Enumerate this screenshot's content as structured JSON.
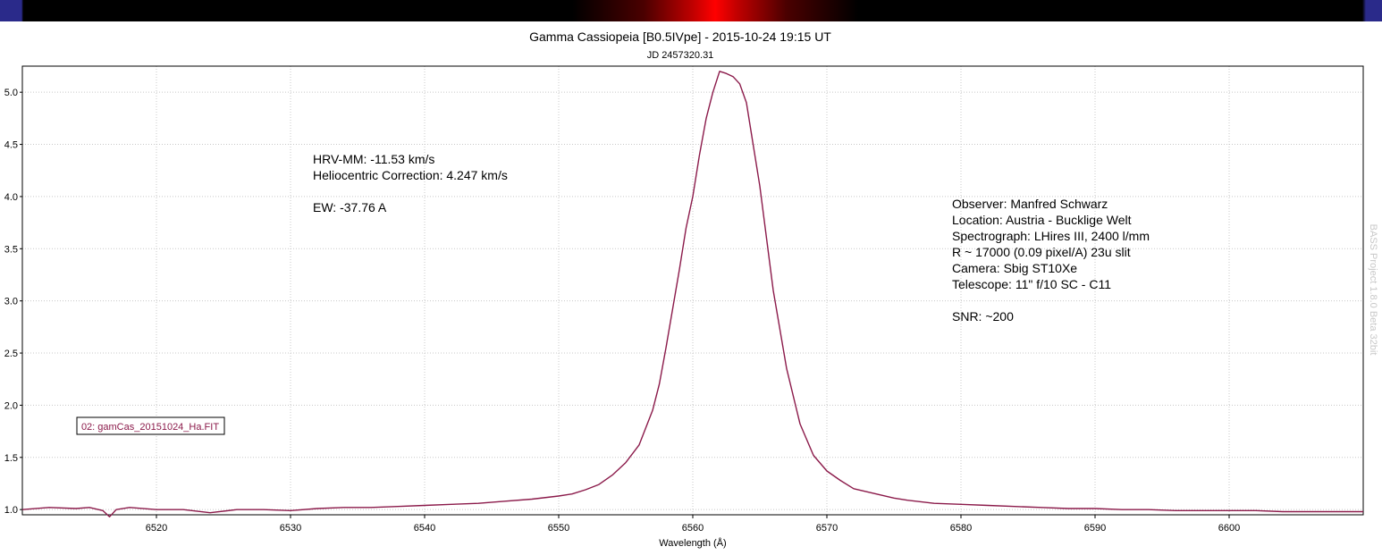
{
  "colors": {
    "series": "#8b1a4a",
    "axis": "#000000",
    "grid": "#c8c8c8",
    "topbar": "#ff0000"
  },
  "chart_data": {
    "type": "line",
    "title": "Gamma Cassiopeia [B0.5IVpe] - 2015-10-24 19:15 UT",
    "subtitle": "JD 2457320.31",
    "xlabel": "Wavelength (Å)",
    "ylabel": "",
    "xlim": [
      6510,
      6610
    ],
    "ylim": [
      0.95,
      5.25
    ],
    "grid": true,
    "xticks": [
      6520,
      6530,
      6540,
      6550,
      6560,
      6570,
      6580,
      6590,
      6600
    ],
    "xtick_labels": [
      "6520",
      "6530",
      "6540",
      "6550",
      "6560",
      "6570",
      "6580",
      "6590",
      "6600"
    ],
    "yticks": [
      1.0,
      1.5,
      2.0,
      2.5,
      3.0,
      3.5,
      4.0,
      4.5,
      5.0
    ],
    "ytick_labels": [
      "1.0",
      "1.5",
      "2.0",
      "2.5",
      "3.0",
      "3.5",
      "4.0",
      "4.5",
      "5.0"
    ],
    "legend": {
      "placement": "lower-left",
      "entries": [
        "02: gamCas_20151024_Ha.FIT"
      ]
    },
    "series": [
      {
        "x": [
          6510,
          6512,
          6514,
          6515,
          6516,
          6516.5,
          6517,
          6518,
          6520,
          6522,
          6524,
          6526,
          6528,
          6530,
          6532,
          6534,
          6536,
          6538,
          6540,
          6542,
          6544,
          6546,
          6548,
          6550,
          6551,
          6552,
          6553,
          6554,
          6555,
          6556,
          6557,
          6557.5,
          6558,
          6559,
          6559.5,
          6560,
          6560.5,
          6561,
          6561.5,
          6562,
          6562.5,
          6563,
          6563.5,
          6564,
          6564.5,
          6565,
          6565.5,
          6566,
          6567,
          6568,
          6569,
          6570,
          6571,
          6572,
          6573,
          6574,
          6575,
          6576,
          6578,
          6580,
          6582,
          6584,
          6586,
          6588,
          6590,
          6592,
          6594,
          6596,
          6598,
          6600,
          6602,
          6604,
          6606,
          6608,
          6610
        ],
        "y": [
          1.0,
          1.02,
          1.01,
          1.02,
          0.99,
          0.93,
          1.0,
          1.02,
          1.0,
          1.0,
          0.97,
          1.0,
          1.0,
          0.99,
          1.01,
          1.02,
          1.02,
          1.03,
          1.04,
          1.05,
          1.06,
          1.08,
          1.1,
          1.13,
          1.15,
          1.19,
          1.24,
          1.33,
          1.45,
          1.62,
          1.95,
          2.2,
          2.55,
          3.3,
          3.7,
          4.0,
          4.4,
          4.75,
          5.0,
          5.2,
          5.18,
          5.15,
          5.08,
          4.9,
          4.5,
          4.1,
          3.6,
          3.1,
          2.35,
          1.82,
          1.52,
          1.37,
          1.28,
          1.2,
          1.17,
          1.14,
          1.11,
          1.09,
          1.06,
          1.05,
          1.04,
          1.03,
          1.02,
          1.01,
          1.01,
          1.0,
          1.0,
          0.99,
          0.99,
          0.99,
          0.99,
          0.98,
          0.98,
          0.98,
          0.98
        ]
      }
    ]
  },
  "annotations": {
    "left": [
      "HRV-MM: -11.53 km/s",
      "Heliocentric Correction: 4.247 km/s",
      "",
      "EW: -37.76 A"
    ],
    "right": [
      "Observer: Manfred Schwarz",
      "Location: Austria - Bucklige Welt",
      "Spectrograph: LHires III, 2400 l/mm",
      "R ~ 17000 (0.09 pixel/A) 23u slit",
      "Camera: Sbig ST10Xe",
      "Telescope: 11\" f/10 SC - C11",
      "",
      "SNR: ~200"
    ]
  },
  "watermark": "BASS Project 1.8.0 Beta 32bit"
}
